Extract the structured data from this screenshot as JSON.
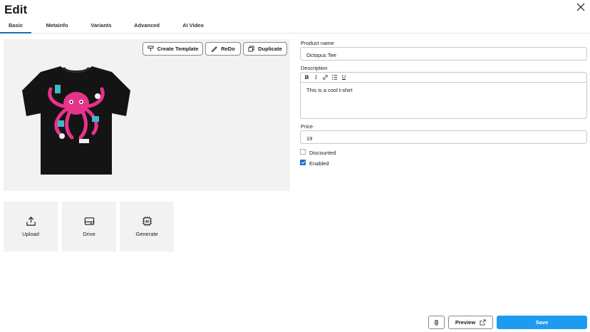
{
  "header": {
    "title": "Edit"
  },
  "tabs": [
    {
      "label": "Basic",
      "active": true
    },
    {
      "label": "Metainfo"
    },
    {
      "label": "Variants"
    },
    {
      "label": "Advanced"
    },
    {
      "label": "AI Video"
    }
  ],
  "toolbar": {
    "create_template": "Create Template",
    "redo": "ReDo",
    "duplicate": "Duplicate"
  },
  "sources": [
    {
      "label": "Upload",
      "icon": "upload-icon"
    },
    {
      "label": "Drive",
      "icon": "drive-icon"
    },
    {
      "label": "Generate",
      "icon": "ai-chip-icon"
    }
  ],
  "form": {
    "product_name_label": "Product name",
    "product_name_value": "Octopus Tee",
    "description_label": "Description",
    "description_value": "This is a cool t-shirt",
    "price_label": "Price",
    "price_value": "19",
    "discounted_label": "Discounted",
    "discounted_checked": false,
    "enabled_label": "Enabled",
    "enabled_checked": true
  },
  "footer": {
    "preview_label": "Preview",
    "save_label": "Save"
  },
  "colors": {
    "accent": "#1e9bf0",
    "tab_underline": "#1a6fb0",
    "tile_bg": "#f2f2f2",
    "shirt": "#141414",
    "octopus": "#e8338a"
  }
}
